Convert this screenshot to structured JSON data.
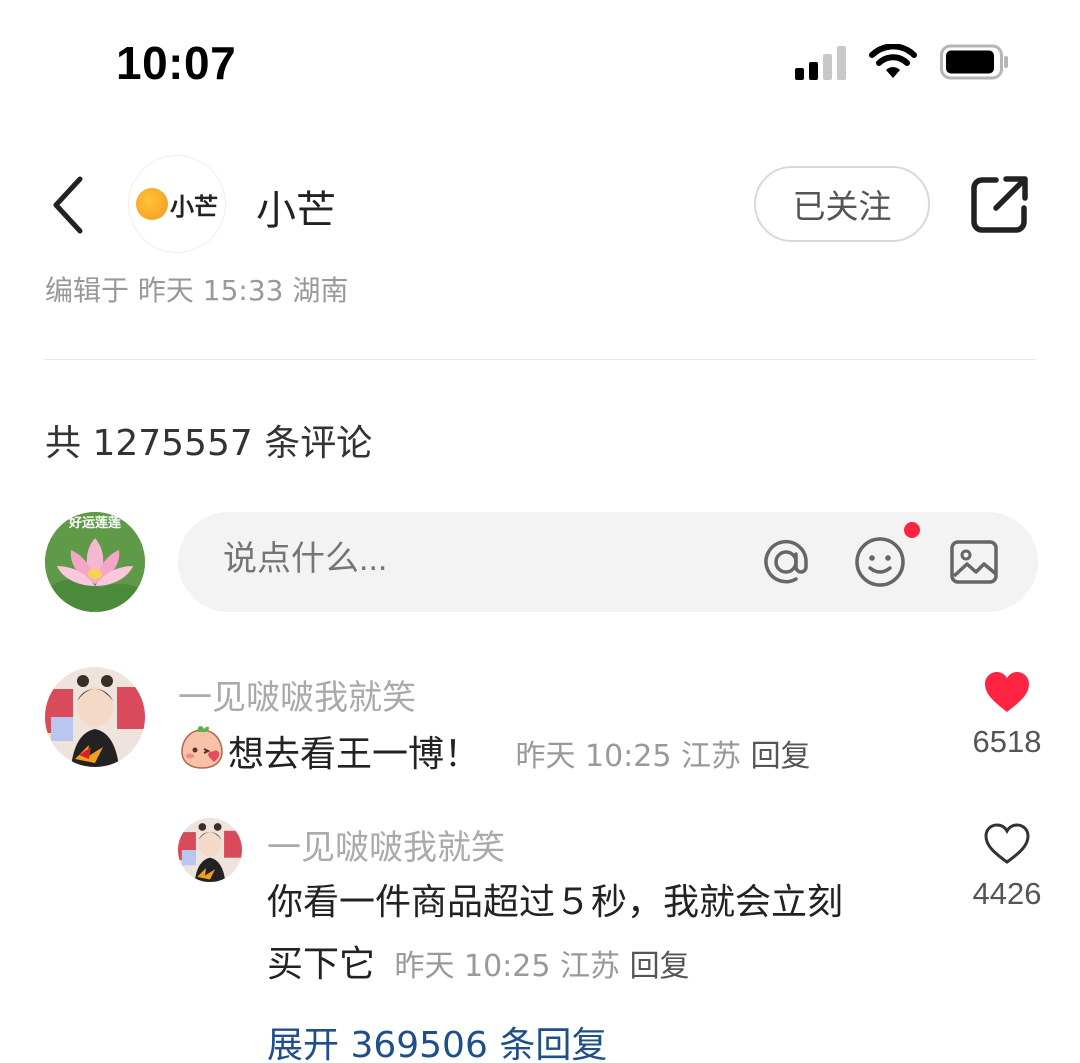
{
  "status_bar": {
    "time": "10:07"
  },
  "header": {
    "logo_text": "小芒",
    "account_name": "小芒",
    "follow_label": "已关注"
  },
  "post": {
    "edit_info": "编辑于 昨天 15:33 湖南"
  },
  "comments_header": {
    "count_label": "共 1275557 条评论"
  },
  "input": {
    "placeholder": "说点什么...",
    "avatar_badge": "好运莲莲"
  },
  "comments": [
    {
      "user": "一见啵啵我就笑",
      "text": "想去看王一博！",
      "time": "昨天 10:25",
      "location": "江苏",
      "reply_label": "回复",
      "likes": "6518",
      "liked": true,
      "replies": [
        {
          "user": "一见啵啵我就笑",
          "text_line1": "你看一件商品超过５秒，我就会立刻",
          "text_line2": "买下它",
          "time": "昨天 10:25",
          "location": "江苏",
          "reply_label": "回复",
          "likes": "4426",
          "liked": false
        }
      ],
      "expand_label": "展开 369506 条回复"
    }
  ],
  "colors": {
    "accent_red": "#ff2442",
    "link_blue": "#1f4f8b"
  },
  "icons": [
    "back-icon",
    "share-icon",
    "at-icon",
    "emoji-icon",
    "image-icon",
    "heart-filled-icon",
    "heart-outline-icon"
  ]
}
